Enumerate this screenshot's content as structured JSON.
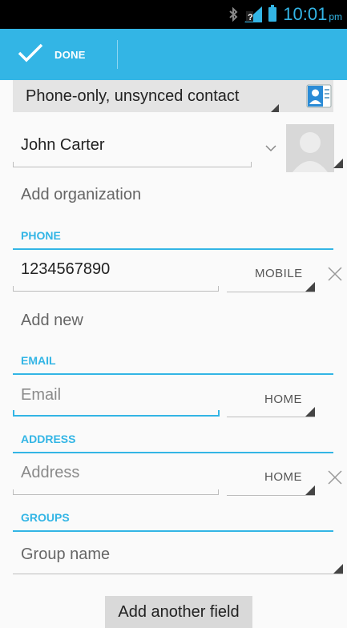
{
  "status_bar": {
    "time": "10:01",
    "ampm": "pm",
    "accent_color": "#33b5e5"
  },
  "action_bar": {
    "done_label": "DONE",
    "color": "#33b5e5"
  },
  "account": {
    "label": "Phone-only, unsynced contact"
  },
  "name_field": {
    "value": "John Carter"
  },
  "organization": {
    "label": "Add organization"
  },
  "phone": {
    "header": "PHONE",
    "value": "1234567890",
    "type": "MOBILE",
    "add_new": "Add new"
  },
  "email": {
    "header": "EMAIL",
    "placeholder": "Email",
    "type": "HOME"
  },
  "address": {
    "header": "ADDRESS",
    "placeholder": "Address",
    "type": "HOME"
  },
  "groups": {
    "header": "GROUPS",
    "placeholder": "Group name"
  },
  "add_field_button": {
    "label": "Add another field"
  },
  "icons": [
    "bluetooth-icon",
    "no-sim-signal-icon",
    "battery-icon",
    "done-check-icon",
    "contact-card-icon",
    "expand-chevron-icon",
    "avatar-icon",
    "remove-icon"
  ]
}
